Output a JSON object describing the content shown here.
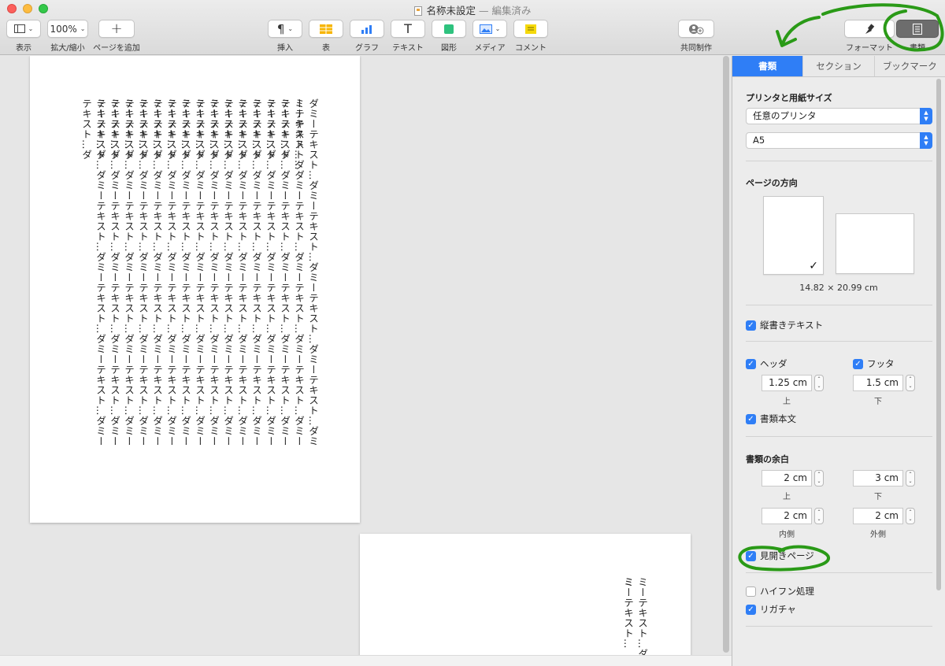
{
  "window": {
    "title": "名称未設定",
    "status": "— 編集済み"
  },
  "toolbar": {
    "view_label": "表示",
    "zoom_value": "100%",
    "zoom_label": "拡大/縮小",
    "add_page_label": "ページを追加",
    "insert_label": "挿入",
    "table_label": "表",
    "chart_label": "グラフ",
    "text_label": "テキスト",
    "shape_label": "図形",
    "media_label": "メディア",
    "comment_label": "コメント",
    "collaborate_label": "共同制作",
    "format_label": "フォーマット",
    "document_label": "書類"
  },
  "canvas": {
    "page1_columns": [
      "ダミーテキスト…ダミーテキスト…ダミーテキスト…ダミーテキスト…ダミーテキスト…ダ",
      "ミーテキスト…ダミーテキスト…ダミーテキスト…ダミーテキスト…ダミーテキスト…ダ",
      "ミーテキスト…ダミーテキスト…ダミーテキスト…ダミーテキスト…ダミーテキスト…ダ",
      "ミーテキスト…ダミーテキスト…ダミーテキスト…ダミーテキスト…ダミーテキスト…ダ",
      "ミーテキスト…ダミーテキスト…ダミーテキスト…ダミーテキスト…ダミーテキスト…ダ",
      "ミーテキスト…ダミーテキスト…ダミーテキスト…ダミーテキスト…ダミーテキスト…ダ",
      "ミーテキスト…ダミーテキスト…ダミーテキスト…ダミーテキスト…ダミーテキスト…ダ",
      "ミーテキスト…ダミーテキスト…ダミーテキスト…ダミーテキスト…ダミーテキスト…ダ",
      "ミーテキスト…ダミーテキスト…ダミーテキスト…ダミーテキスト…ダミーテキスト…ダ",
      "ミーテキスト…ダミーテキスト…ダミーテキスト…ダミーテキスト…ダミーテキスト…ダ",
      "ミーテキスト…ダミーテキスト…ダミーテキスト…ダミーテキスト…ダミーテキスト…ダ",
      "ミーテキスト…ダミーテキスト…ダミーテキスト…ダミーテキスト…ダミーテキスト…ダ",
      "ミーテキスト…ダミーテキスト…ダミーテキスト…ダミーテキスト…ダミーテキスト…ダ",
      "ミーテキスト…ダミーテキスト…ダミーテキスト…ダミーテキスト…ダミーテキスト…ダ",
      "ミーテキスト…ダミーテキスト…ダミーテキスト…ダミーテキスト…ダミーテキスト…ダ",
      "ミーテキスト…ダミーテキスト…ダミーテキスト…ダミーテキスト…ダミーテキスト…ダ"
    ],
    "page2_columns": [
      "ミーテキスト…ダミ",
      "ミーテキスト…"
    ]
  },
  "inspector": {
    "tabs": [
      "書類",
      "セクション",
      "ブックマーク"
    ],
    "printer_section": "プリンタと用紙サイズ",
    "printer_value": "任意のプリンタ",
    "paper_value": "A5",
    "orientation_section": "ページの方向",
    "dimensions": "14.82 × 20.99 cm",
    "vertical_text": "縦書きテキスト",
    "header_label": "ヘッダ",
    "footer_label": "フッタ",
    "header_value": "1.25 cm",
    "footer_value": "1.5 cm",
    "header_sub": "上",
    "footer_sub": "下",
    "body_label": "書類本文",
    "margins_section": "書類の余白",
    "margin_top": "2 cm",
    "margin_bottom": "3 cm",
    "margin_inside": "2 cm",
    "margin_outside": "2 cm",
    "margin_top_label": "上",
    "margin_bottom_label": "下",
    "margin_inside_label": "内側",
    "margin_outside_label": "外側",
    "facing_pages": "見開きページ",
    "hyphenation": "ハイフン処理",
    "ligatures": "リガチャ"
  },
  "colors": {
    "accent": "#2f7ef6",
    "annotation": "#2a9a17"
  }
}
